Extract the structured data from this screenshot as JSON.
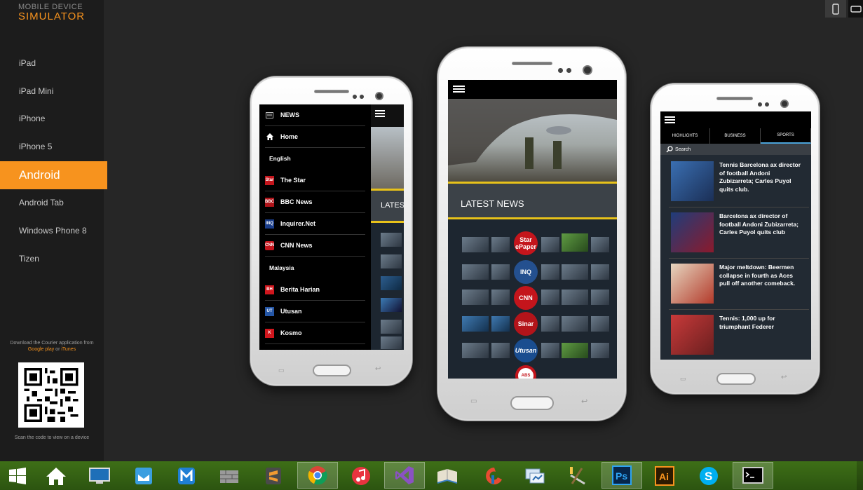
{
  "brand": {
    "line1": "MOBILE DEVICE",
    "line2": "SIMULATOR"
  },
  "nav": [
    {
      "label": "iPad"
    },
    {
      "label": "iPad Mini"
    },
    {
      "label": "iPhone"
    },
    {
      "label": "iPhone 5"
    },
    {
      "label": "Android",
      "active": true
    },
    {
      "label": "Android Tab"
    },
    {
      "label": "Windows Phone 8"
    },
    {
      "label": "Tizen"
    }
  ],
  "download": {
    "pre": "Download the Courier application from",
    "gp": "Google play",
    "or": "or",
    "it": "iTunes"
  },
  "scan": "Scan the code to view on a device",
  "phone1": {
    "title": "NEWS",
    "home": "Home",
    "sec_en": "English",
    "items_en": [
      {
        "label": "The Star",
        "icon": "Star"
      },
      {
        "label": "BBC News",
        "icon": "BBC"
      },
      {
        "label": "Inquirer.Net",
        "icon": "INQ"
      },
      {
        "label": "CNN News",
        "icon": "CNN"
      }
    ],
    "sec_my": "Malaysia",
    "items_my": [
      {
        "label": "Berita Harian",
        "icon": "BH"
      },
      {
        "label": "Utusan",
        "icon": "UT"
      },
      {
        "label": "Kosmo",
        "icon": "K"
      }
    ],
    "peek": "LATES"
  },
  "phone2": {
    "banner": "LATEST NEWS",
    "logos": [
      "Star ePaper",
      "INQ",
      "CNN",
      "Sinar",
      "Utusan",
      "ABS"
    ]
  },
  "phone3": {
    "tabs": [
      "HIGHLIGHTS",
      "BUSINESS",
      "SPORTS"
    ],
    "active_tab": "SPORTS",
    "search_placeholder": "Search",
    "articles": [
      {
        "title": "Tennis Barcelona ax director of football Andoni Zubizarreta; Carles Puyol quits club."
      },
      {
        "title": "Barcelona ax director of football Andoni Zubizarreta; Carles Puyol quits club"
      },
      {
        "title": "Major meltdown: Beermen collapse in fourth as Aces pull off another comeback."
      },
      {
        "title": "Tennis: 1,000 up for triumphant Federer"
      }
    ]
  },
  "colors": {
    "accent": "#f7931e",
    "highlight_yellow": "#e8c21a",
    "tab_blue": "#4aa3d8"
  },
  "taskbar": [
    "windows-start-icon",
    "home-icon",
    "monitor-icon",
    "mail-icon",
    "maxthon-icon",
    "wall-icon",
    "sublime-icon",
    "chrome-icon",
    "itunes-icon",
    "visual-studio-icon",
    "book-icon",
    "ccleaner-icon",
    "network-icon",
    "tools-icon",
    "photoshop-icon",
    "illustrator-icon",
    "skype-icon",
    "terminal-icon"
  ]
}
